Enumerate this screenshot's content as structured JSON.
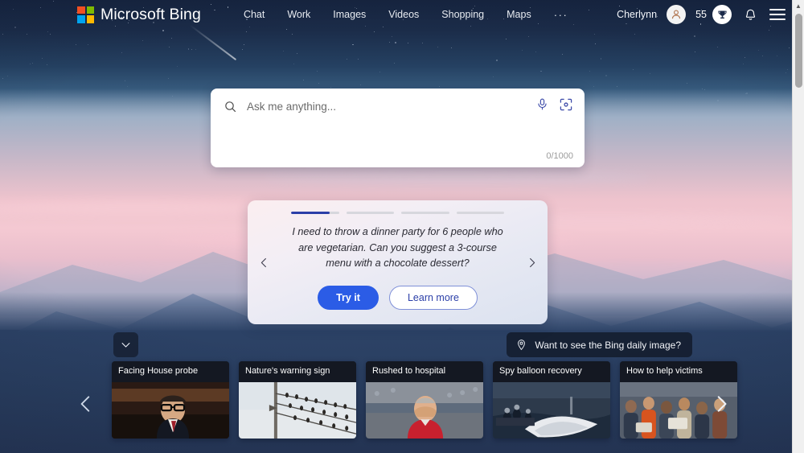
{
  "header": {
    "brand": "Microsoft Bing",
    "logo_colors": [
      "#f25022",
      "#7fba00",
      "#00a4ef",
      "#ffb900"
    ],
    "nav": [
      {
        "label": "Chat",
        "name": "nav-chat"
      },
      {
        "label": "Work",
        "name": "nav-work"
      },
      {
        "label": "Images",
        "name": "nav-images"
      },
      {
        "label": "Videos",
        "name": "nav-videos"
      },
      {
        "label": "Shopping",
        "name": "nav-shopping"
      },
      {
        "label": "Maps",
        "name": "nav-maps"
      }
    ],
    "more_label": "···",
    "user_name": "Cherlynn",
    "rewards_count": "55",
    "avatar_icon": "person-icon",
    "trophy_icon": "trophy-icon",
    "notification_icon": "bell-icon",
    "menu_icon": "hamburger-icon"
  },
  "search": {
    "placeholder": "Ask me anything...",
    "value": "",
    "char_counter": "0/1000",
    "search_icon": "search-icon",
    "mic_icon": "microphone-icon",
    "lens_icon": "visual-search-icon"
  },
  "suggestion_card": {
    "text": "I need to throw a dinner party for 6 people who are vegetarian. Can you suggest a 3-course menu with a chocolate dessert?",
    "primary_button": "Try it",
    "secondary_button": "Learn more",
    "prev_icon": "chevron-left-icon",
    "next_icon": "chevron-right-icon",
    "progress": {
      "total": 4,
      "active_index": 0,
      "active_fill_percent": 80
    },
    "accent_color": "#2b5ce6",
    "progress_color": "#2b3fa8"
  },
  "daily_image": {
    "label": "Want to see the Bing daily image?",
    "icon": "location-pin-icon"
  },
  "collapse": {
    "icon": "chevron-down-icon"
  },
  "carousel": {
    "prev_icon": "chevron-left-icon",
    "next_icon": "chevron-right-icon",
    "cards": [
      {
        "title": "Facing House probe",
        "thumb": "man-in-suit-at-hearing"
      },
      {
        "title": "Nature's warning sign",
        "thumb": "birds-on-power-lines"
      },
      {
        "title": "Rushed to hospital",
        "thumb": "man-in-red-shirt-stadium"
      },
      {
        "title": "Spy balloon recovery",
        "thumb": "navy-crew-recovering-debris"
      },
      {
        "title": "How to help victims",
        "thumb": "crowd-receiving-aid"
      }
    ]
  },
  "scrollbar": {
    "up_arrow": "▲"
  }
}
